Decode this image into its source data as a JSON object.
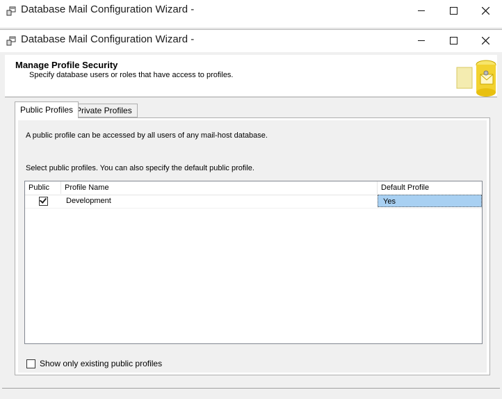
{
  "back_window": {
    "title": "Database Mail Configuration Wizard -"
  },
  "window": {
    "title": "Database Mail Configuration Wizard -",
    "controls": [
      "minimize",
      "maximize",
      "close"
    ]
  },
  "header": {
    "title": "Manage Profile Security",
    "subtitle": "Specify database users or roles that have access to profiles."
  },
  "tabs": [
    {
      "label": "Public Profiles",
      "active": true
    },
    {
      "label": "Private Profiles",
      "active": false
    }
  ],
  "panel": {
    "description": "A public profile can be accessed by all users of any mail-host database.",
    "instruction": "Select public profiles. You can also specify the default public profile."
  },
  "grid": {
    "columns": [
      "Public",
      "Profile Name",
      "Default Profile"
    ],
    "rows": [
      {
        "public": true,
        "profile_name": "Development",
        "default_profile": "Yes"
      }
    ]
  },
  "show_only_existing": {
    "label": "Show only existing public profiles",
    "checked": false
  },
  "colors": {
    "selected_cell": "#a8d0f2",
    "header_bg": "#ffffff",
    "panel_bg": "#f0f0f0"
  }
}
